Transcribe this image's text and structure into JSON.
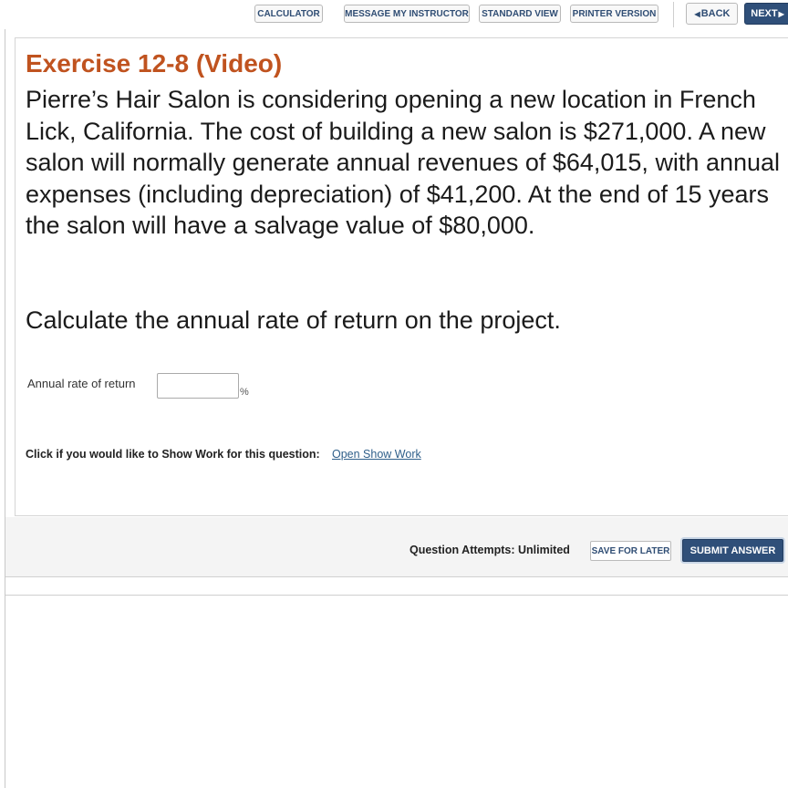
{
  "toolbar": {
    "calculator": "CALCULATOR",
    "message_instructor": "MESSAGE MY INSTRUCTOR",
    "standard_view": "STANDARD VIEW",
    "printer_version": "PRINTER VERSION",
    "back": "BACK",
    "next": "NEXT"
  },
  "question": {
    "title": "Exercise 12-8 (Video)",
    "body": "Pierre’s Hair Salon is considering opening a new location in French Lick, California. The cost of building a new salon is $271,000. A new salon will normally generate annual revenues of $64,015, with annual expenses (including depreciation) of $41,200. At the end of 15 years the salon will have a salvage value of $80,000.",
    "prompt": "Calculate the annual rate of return on the project."
  },
  "answer": {
    "label": "Annual rate of return",
    "value": "",
    "unit": "%"
  },
  "show_work": {
    "text": "Click if you would like to Show Work for this question:",
    "link": "Open Show Work"
  },
  "footer": {
    "attempts": "Question Attempts: Unlimited",
    "save": "SAVE FOR LATER",
    "submit": "SUBMIT ANSWER"
  },
  "colors": {
    "title": "#c0531f",
    "primary_button": "#2f4f79",
    "link": "#2f5f8a"
  }
}
